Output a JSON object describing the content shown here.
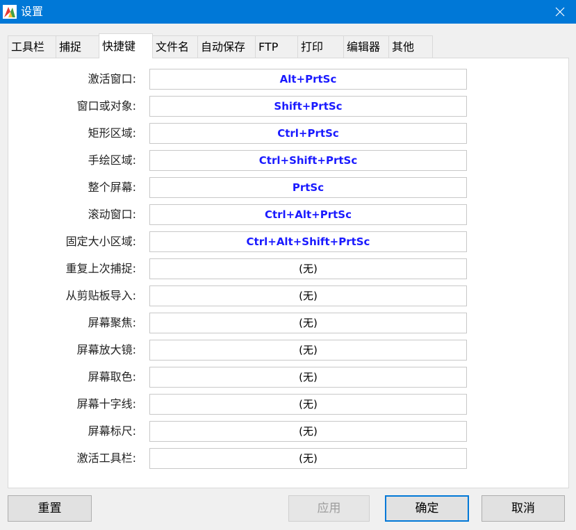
{
  "window": {
    "title": "设置",
    "close_icon": "close-icon",
    "app_icon": "app-logo-icon"
  },
  "tabs": [
    {
      "label": "工具栏",
      "active": false
    },
    {
      "label": "捕捉",
      "active": false
    },
    {
      "label": "快捷键",
      "active": true
    },
    {
      "label": "文件名",
      "active": false
    },
    {
      "label": "自动保存",
      "active": false
    },
    {
      "label": "FTP",
      "active": false
    },
    {
      "label": "打印",
      "active": false
    },
    {
      "label": "编辑器",
      "active": false
    },
    {
      "label": "其他",
      "active": false
    }
  ],
  "hotkeys": [
    {
      "label": "激活窗口:",
      "value": "Alt+PrtSc",
      "assigned": true
    },
    {
      "label": "窗口或对象:",
      "value": "Shift+PrtSc",
      "assigned": true
    },
    {
      "label": "矩形区域:",
      "value": "Ctrl+PrtSc",
      "assigned": true
    },
    {
      "label": "手绘区域:",
      "value": "Ctrl+Shift+PrtSc",
      "assigned": true
    },
    {
      "label": "整个屏幕:",
      "value": "PrtSc",
      "assigned": true
    },
    {
      "label": "滚动窗口:",
      "value": "Ctrl+Alt+PrtSc",
      "assigned": true
    },
    {
      "label": "固定大小区域:",
      "value": "Ctrl+Alt+Shift+PrtSc",
      "assigned": true
    },
    {
      "label": "重复上次捕捉:",
      "value": "(无)",
      "assigned": false
    },
    {
      "label": "从剪贴板导入:",
      "value": "(无)",
      "assigned": false
    },
    {
      "label": "屏幕聚焦:",
      "value": "(无)",
      "assigned": false
    },
    {
      "label": "屏幕放大镜:",
      "value": "(无)",
      "assigned": false
    },
    {
      "label": "屏幕取色:",
      "value": "(无)",
      "assigned": false
    },
    {
      "label": "屏幕十字线:",
      "value": "(无)",
      "assigned": false
    },
    {
      "label": "屏幕标尺:",
      "value": "(无)",
      "assigned": false
    },
    {
      "label": "激活工具栏:",
      "value": "(无)",
      "assigned": false
    }
  ],
  "buttons": {
    "reset": "重置",
    "apply": "应用",
    "ok": "确定",
    "cancel": "取消"
  },
  "colors": {
    "titlebar": "#0078d7",
    "hotkey_assigned": "#1a1aff",
    "default_button_border": "#0078d7"
  }
}
